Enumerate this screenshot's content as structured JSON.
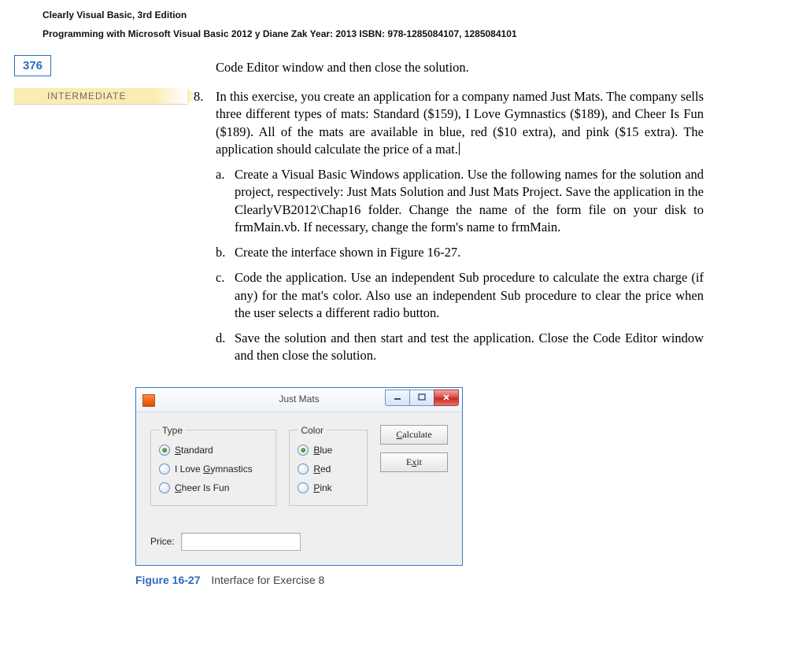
{
  "header": {
    "title": "Clearly Visual Basic, 3rd Edition",
    "subtitle": "Programming with Microsoft Visual Basic 2012  y Diane Zak Year: 2013  ISBN: 978-1285084107, 1285084101"
  },
  "page_number": "376",
  "running_head": "Code Editor window and then close the solution.",
  "level_label": "INTERMEDIATE",
  "exercise": {
    "number": "8.",
    "intro": "In this exercise, you create an application for a company named Just Mats. The company sells three different types of mats: Standard ($159), I Love Gymnastics ($189), and Cheer Is Fun ($189). All of the mats are available in blue, red ($10 extra), and pink ($15 extra). The application should calculate the price of a mat.",
    "items": [
      {
        "label": "a.",
        "text": "Create a Visual Basic Windows application. Use the following names for the solution and project, respectively: Just Mats Solution and Just Mats Project. Save the application in the ClearlyVB2012\\Chap16 folder. Change the name of the form file on your disk to frmMain.vb. If necessary, change the form's name to frmMain."
      },
      {
        "label": "b.",
        "text": "Create the interface shown in Figure 16-27."
      },
      {
        "label": "c.",
        "text": "Code the application. Use an independent Sub procedure to calculate the extra charge (if any) for the mat's color. Also use an independent Sub procedure to clear the price when the user selects a different radio button."
      },
      {
        "label": "d.",
        "text": "Save the solution and then start and test the application. Close the Code Editor window and then close the solution."
      }
    ]
  },
  "window": {
    "title": "Just Mats",
    "groups": {
      "type": {
        "legend": "Type",
        "options": [
          {
            "accel": "S",
            "rest": "tandard",
            "selected": true
          },
          {
            "pre": "I Love ",
            "accel": "G",
            "rest": "ymnastics",
            "selected": false
          },
          {
            "accel": "C",
            "rest": "heer Is Fun",
            "selected": false
          }
        ]
      },
      "color": {
        "legend": "Color",
        "options": [
          {
            "accel": "B",
            "rest": "lue",
            "selected": true
          },
          {
            "accel": "R",
            "rest": "ed",
            "selected": false
          },
          {
            "accel": "P",
            "rest": "ink",
            "selected": false
          }
        ]
      }
    },
    "buttons": {
      "calculate": {
        "accel": "C",
        "rest": "alculate"
      },
      "exit": {
        "pre": "E",
        "accel": "x",
        "rest": "it"
      }
    },
    "price_label": "Price:",
    "price_value": ""
  },
  "figure": {
    "label": "Figure 16-27",
    "caption": "Interface for Exercise 8"
  }
}
